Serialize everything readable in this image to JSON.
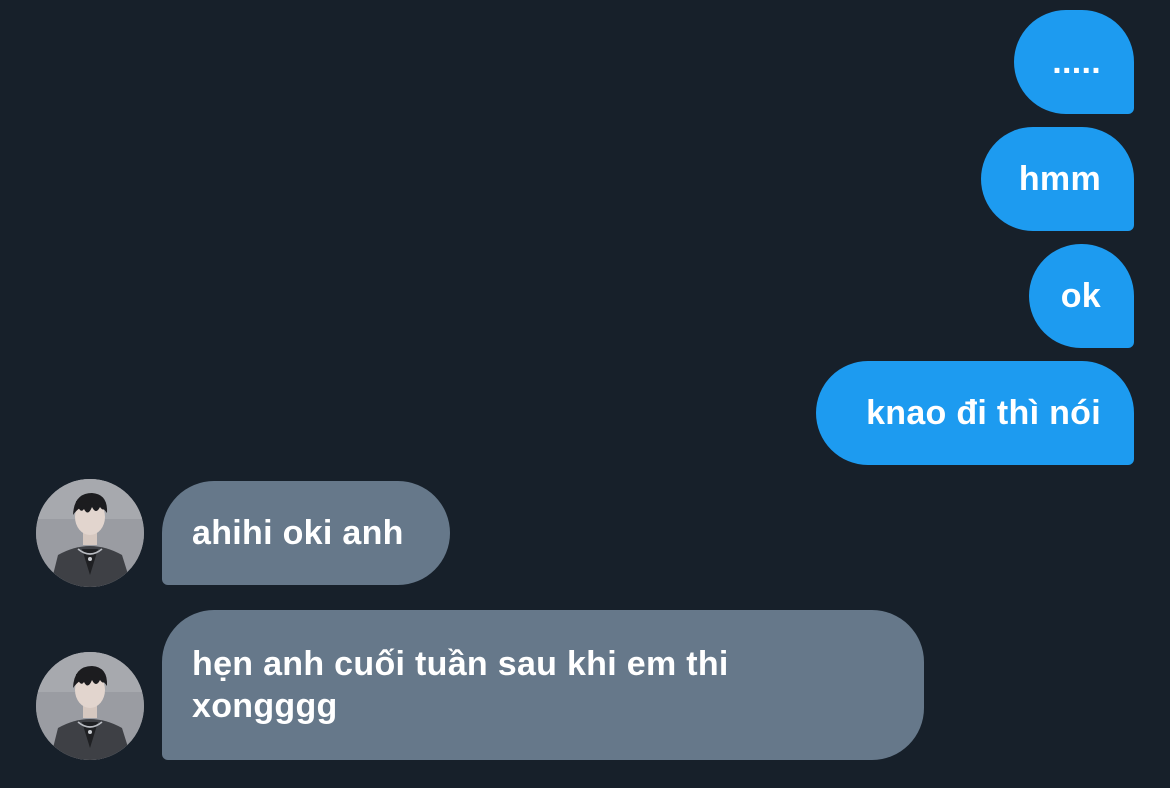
{
  "colors": {
    "background": "#17202a",
    "outgoing_bubble": "#1d9bf0",
    "incoming_bubble": "#66788a",
    "text": "#ffffff"
  },
  "messages": {
    "outgoing": [
      {
        "text": "....."
      },
      {
        "text": "hmm"
      },
      {
        "text": "ok"
      },
      {
        "text": "knao đi thì nói"
      }
    ],
    "incoming": [
      {
        "text": "ahihi oki anh",
        "avatar_icon": "user-avatar-icon"
      },
      {
        "text": "hẹn anh cuối tuần sau khi em thi xongggg",
        "avatar_icon": "user-avatar-icon"
      }
    ]
  }
}
